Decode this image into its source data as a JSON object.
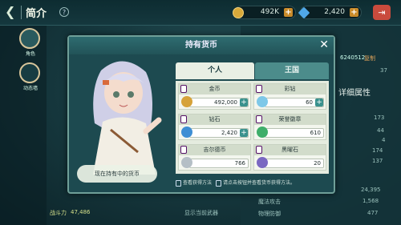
{
  "header": {
    "back_icon": "back-arrow-icon",
    "title": "简介",
    "help": "?"
  },
  "currencies": [
    {
      "icon": "gold-coin-icon",
      "value": "492K",
      "color": "#d8a93a"
    },
    {
      "icon": "diamond-icon",
      "value": "2,420",
      "color": "#4fa7e8"
    }
  ],
  "sidebar": [
    {
      "label": "角色"
    },
    {
      "label": "动态墙"
    }
  ],
  "background": {
    "uid": "6240512",
    "copy": "复制",
    "level": "37",
    "tab": "详细属性",
    "stats": [
      "173",
      "44",
      "4",
      "174",
      "137",
      "24,395",
      "1,568",
      "477"
    ],
    "stat_labels": [
      "魔法攻击",
      "物理防御"
    ],
    "combat_label": "战斗力",
    "combat_value": "47,486",
    "show_weapon": "显示当前武器"
  },
  "modal": {
    "title": "持有货币",
    "tabs": [
      {
        "label": "个人"
      },
      {
        "label": "王国"
      }
    ],
    "cells": [
      {
        "name": "金币",
        "value": "492,000",
        "icon": "gold-coin-icon",
        "color": "#d6a23a",
        "plus": true
      },
      {
        "name": "彩钻",
        "value": "60",
        "icon": "rainbow-diamond-icon",
        "color": "#7ec8e8",
        "plus": true
      },
      {
        "name": "钻石",
        "value": "2,420",
        "icon": "diamond-icon",
        "color": "#3e8ed4",
        "plus": true
      },
      {
        "name": "荣誉徽章",
        "value": "610",
        "icon": "honor-badge-icon",
        "color": "#3fae6a",
        "plus": false
      },
      {
        "name": "吉尔德币",
        "value": "766",
        "icon": "gild-coin-icon",
        "color": "#b5bfc6",
        "plus": false
      },
      {
        "name": "黑曜石",
        "value": "20",
        "icon": "obsidian-icon",
        "color": "#7a68c2",
        "plus": false
      }
    ],
    "footer": {
      "a": "查看获得方法",
      "b": "请点击按钮并查看货币获得方法。"
    },
    "speech": "现在持有中的货币"
  }
}
